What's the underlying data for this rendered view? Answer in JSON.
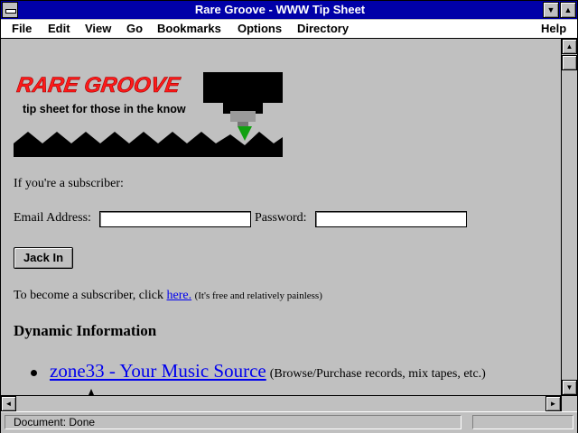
{
  "window": {
    "title": "Rare Groove - WWW Tip Sheet"
  },
  "menubar": {
    "items": [
      {
        "label": "File"
      },
      {
        "label": "Edit"
      },
      {
        "label": "View"
      },
      {
        "label": "Go"
      },
      {
        "label": "Bookmarks"
      },
      {
        "label": "Options"
      },
      {
        "label": "Directory"
      },
      {
        "label": "Help"
      }
    ]
  },
  "logo": {
    "title": "RARE GROOVE",
    "tagline": "tip sheet for those in the know",
    "colors": {
      "title": "#ff1a1a",
      "accent": "#10a010"
    }
  },
  "content": {
    "subscriber_prompt": "If you're a subscriber:",
    "email_label": "Email Address:",
    "email_value": "",
    "password_label": "Password:",
    "password_value": "",
    "submit_label": "Jack In",
    "become_text": "To become a subscriber, click",
    "here_link": "here.",
    "free_note": "(It's free and relatively painless)",
    "section_heading": "Dynamic Information",
    "list": [
      {
        "link": "zone33 - Your Music Source",
        "desc": "(Browse/Purchase records, mix tapes, etc.)"
      }
    ]
  },
  "icons": {
    "system_menu": "system-menu-icon",
    "minimize": "minimize-icon",
    "maximize": "maximize-icon"
  },
  "status": {
    "text": "Document: Done"
  },
  "colors": {
    "titlebar": "#0000a8",
    "link": "#0000ee",
    "background": "#c0c0c0"
  }
}
